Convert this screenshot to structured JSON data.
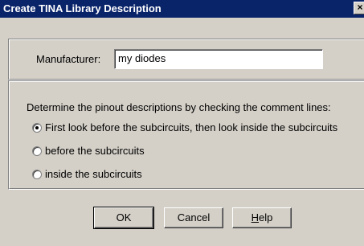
{
  "window": {
    "title": "Create TINA Library Description",
    "close_glyph": "×"
  },
  "manufacturer": {
    "label": "Manufacturer:",
    "value": "my diodes"
  },
  "pinout": {
    "instruction": "Determine the pinout descriptions by checking the comment lines:",
    "options": [
      {
        "label": "First look before the subcircuits, then look inside the subcircuits",
        "checked": true
      },
      {
        "label": "before the subcircuits",
        "checked": false
      },
      {
        "label": "inside the subcircuits",
        "checked": false
      }
    ]
  },
  "buttons": {
    "ok": "OK",
    "cancel": "Cancel",
    "help_first": "H",
    "help_rest": "elp"
  }
}
